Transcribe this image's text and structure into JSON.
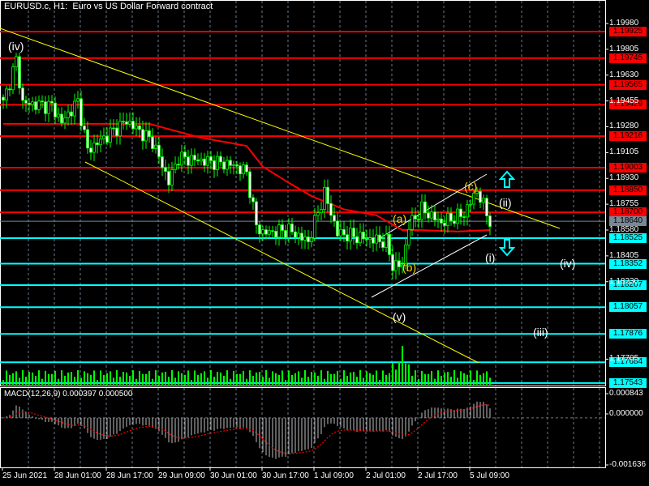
{
  "header": {
    "title": "EURUSD.c, H1:  Euro vs US Dollar Forward contract"
  },
  "macd": {
    "label": "MACD(12,26,9) 0.000397 0.000500",
    "scale_labels": [
      "0.000843",
      "0.000000",
      "-0.001636"
    ],
    "scale_values": [
      0.000843,
      0,
      -0.001636
    ]
  },
  "colors": {
    "background": "#000000",
    "candle": "#00ff00",
    "resistance": "#ff0000",
    "support": "#00ffff",
    "trendline": "#ffff00",
    "ma": "#ff0000",
    "current": "#778899"
  },
  "chart_data": {
    "type": "candlestick",
    "symbol": "EURUSD.c",
    "timeframe": "H1",
    "price_range": [
      1.17526,
      1.20139
    ],
    "current_price": "1.18640",
    "price_scale_labels": [
      "1.19980",
      "1.19805",
      "1.19630",
      "1.19455",
      "1.19280",
      "1.19105",
      "1.18930",
      "1.18755",
      "1.18580",
      "1.18405",
      "1.18230",
      "1.17705"
    ],
    "resistance_levels": [
      "1.19925",
      "1.19745",
      "1.19565",
      "1.19429",
      "1.19216",
      "1.19003",
      "1.18850",
      "1.18700"
    ],
    "support_levels": [
      "1.18525",
      "1.18352",
      "1.18207",
      "1.18057",
      "1.17876",
      "1.17684",
      "1.17543"
    ],
    "time_labels": [
      "25 Jun 2021",
      "28 Jun 01:00",
      "28 Jun 17:00",
      "29 Jun 09:00",
      "30 Jun 01:00",
      "30 Jun 17:00",
      "1 Jul 09:00",
      "2 Jul 01:00",
      "2 Jul 17:00",
      "5 Jul 09:00"
    ],
    "close_anchors": [
      [
        0,
        1.1944
      ],
      [
        4,
        1.1973
      ],
      [
        6,
        1.1944
      ],
      [
        15,
        1.1942
      ],
      [
        18,
        1.1931
      ],
      [
        23,
        1.1945
      ],
      [
        26,
        1.1912
      ],
      [
        38,
        1.1932
      ],
      [
        46,
        1.1918
      ],
      [
        51,
        1.1891
      ],
      [
        54,
        1.1907
      ],
      [
        65,
        1.1904
      ],
      [
        71,
        1.1902
      ],
      [
        75,
        1.1897
      ],
      [
        78,
        1.1861
      ],
      [
        80,
        1.1856
      ],
      [
        88,
        1.1858
      ],
      [
        94,
        1.185
      ],
      [
        99,
        1.1883
      ],
      [
        103,
        1.1856
      ],
      [
        110,
        1.1853
      ],
      [
        118,
        1.185
      ],
      [
        120,
        1.1834
      ],
      [
        123,
        1.1834
      ],
      [
        125,
        1.1861
      ],
      [
        129,
        1.1872
      ],
      [
        135,
        1.1863
      ],
      [
        142,
        1.1869
      ],
      [
        146,
        1.1885
      ],
      [
        150,
        1.1864
      ]
    ],
    "ma_anchors": [
      [
        0,
        1.193
      ],
      [
        45,
        1.193
      ],
      [
        60,
        1.1921
      ],
      [
        75,
        1.1915
      ],
      [
        80,
        1.1901
      ],
      [
        88,
        1.189
      ],
      [
        95,
        1.1881
      ],
      [
        105,
        1.1872
      ],
      [
        115,
        1.1868
      ],
      [
        123,
        1.1858
      ],
      [
        128,
        1.1858
      ],
      [
        140,
        1.1857
      ],
      [
        150,
        1.1858
      ]
    ],
    "wave_labels": [
      "(iv)",
      "(a)",
      "(b)",
      "(c)",
      "(ii)",
      "(i)",
      "(iv)",
      "(v)",
      "(iii)"
    ]
  }
}
